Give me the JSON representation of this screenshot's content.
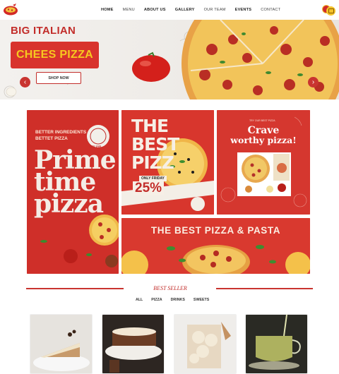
{
  "nav": {
    "items": [
      "HOME",
      "MENU",
      "ABOUT US",
      "GALLERY",
      "OUR TEAM",
      "EVENTS",
      "CONTACT"
    ]
  },
  "hero": {
    "title": "BIG ITALIAN",
    "badge": "CHEES PIZZA",
    "button": "SHOP NOW",
    "prev": "‹",
    "next": "›"
  },
  "posters": {
    "p1": {
      "tagline1": "BETTER INGREDIENTS",
      "tagline2": "BETTET PIZZA",
      "brand": "ITALIAN",
      "word1": "Prime",
      "word2": "time",
      "word3": "pizza"
    },
    "p2": {
      "line1": "THE BEST",
      "line2": "PIZZ",
      "only": "ONLY FRIDAY",
      "pct": "25%"
    },
    "p3": {
      "small": "TRY OUR BEST PIZZA",
      "line1": "Crave",
      "line2": "worthy pizza!"
    },
    "p4": {
      "headline": "THE BEST PIZZA & PASTA"
    }
  },
  "section": {
    "title": "BEST SELLER",
    "tabs": [
      "ALL",
      "PIZZA",
      "DRINKS",
      "SWEETS"
    ]
  },
  "colors": {
    "brand_red": "#c22d2a",
    "accent_yellow": "#f6c81f"
  }
}
